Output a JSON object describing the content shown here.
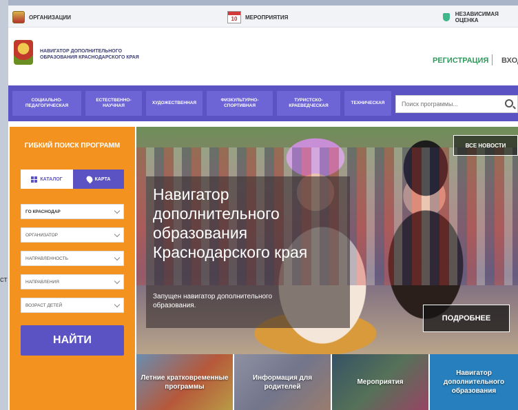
{
  "util": {
    "organizations": "ОРГАНИЗАЦИИ",
    "calendar_day": "10",
    "events": "МЕРОПРИЯТИЯ",
    "independent": "НЕЗАВИСИМАЯ ОЦЕНКА"
  },
  "header": {
    "logo_text": "НАВИГАТОР ДОПОЛНИТЕЛЬНОГО ОБРАЗОВАНИЯ КРАСНОДАРСКОГО КРАЯ",
    "register": "РЕГИСТРАЦИЯ",
    "login": "ВХОД"
  },
  "nav": {
    "items": [
      "СОЦИАЛЬНО-ПЕДАГОГИЧЕСКАЯ",
      "ЕСТЕСТВЕННО-НАУЧНАЯ",
      "ХУДОЖЕСТВЕННАЯ",
      "ФИЗКУЛЬТУРНО-СПОРТИВНАЯ",
      "ТУРИСТСКО-КРАЕВЕДЧЕСКАЯ",
      "ТЕХНИЧЕСКАЯ"
    ],
    "search_placeholder": "Поиск программы..."
  },
  "panel": {
    "title": "ГИБКИЙ ПОИСК ПРОГРАММ",
    "catalog": "КАТАЛОГ",
    "map": "КАРТА",
    "selects": [
      "ГО КРАСНОДАР",
      "ОРГАНИЗАТОР",
      "НАПРАВЛЕННОСТЬ",
      "НАПРАВЛЕНИЯ",
      "ВОЗРАСТ ДЕТЕЙ"
    ],
    "find": "НАЙТИ"
  },
  "hero": {
    "title": "Навигатор дополнительного образования Краснодарского края",
    "subtitle": "Запущен навигатор дополнительного образования.",
    "all_news": "ВСЕ НОВОСТИ",
    "more": "ПОДРОБНЕЕ"
  },
  "tiles": [
    "Летние кратковременные программы",
    "Информация для родителей",
    "Мероприятия",
    "Навигатор дополнительного образования"
  ],
  "gutter_text": "ст"
}
